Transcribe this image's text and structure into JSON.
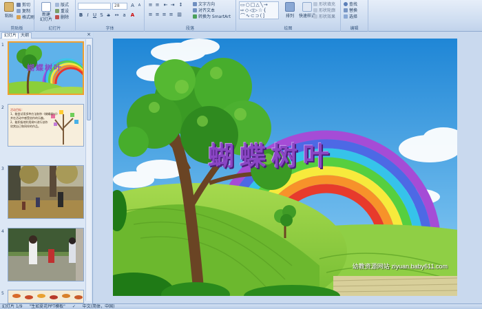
{
  "ribbon": {
    "clipboard": {
      "label": "剪贴板",
      "paste": "粘贴",
      "cut": "剪切",
      "copy": "复制",
      "format_painter": "格式刷"
    },
    "slides": {
      "label": "幻灯片",
      "new_slide": "新建\n幻灯片",
      "layout": "版式",
      "reset": "重设",
      "delete": "删除"
    },
    "font": {
      "label": "字体",
      "font_name": "",
      "font_size": "28"
    },
    "paragraph": {
      "label": "段落",
      "text_direction": "文字方向",
      "align_text": "对齐文本",
      "smartart": "转换为 SmartArt"
    },
    "drawing": {
      "label": "绘图",
      "arrange": "排列",
      "quick_styles": "快速样式",
      "shape_fill": "形状填充",
      "shape_outline": "形状轮廓",
      "shape_effects": "形状效果"
    },
    "editing": {
      "label": "编辑",
      "find": "查找",
      "replace": "替换",
      "select": "选择"
    }
  },
  "panel": {
    "tab_slides": "幻灯片",
    "tab_outline": "大纲",
    "close": "×",
    "slide_numbers": [
      "1",
      "2",
      "3",
      "4",
      "5"
    ],
    "thumb1_title": "蝴蝶树叶",
    "thumb2_lines": [
      "活动目标：",
      "1、能尝试用多种方法制作《蝴蝶树叶》",
      "并在活动中感受创作的乐趣。",
      "2、能积极地利用树叶进行创作",
      "欣赏自己和同伴的作品。"
    ]
  },
  "slide": {
    "title": "蝴蝶树叶",
    "watermark": "幼教资源网站 ziyuan.baby611.com"
  },
  "status": {
    "slide_info": "幻灯片 1/9",
    "theme": "\"生如夏花PPT模板\"",
    "language": "中文(简体，中国)"
  },
  "colors": {
    "ribbon_bg": "#cddcf0",
    "sky": "#4fa6e6",
    "title_purple": "#8a46c4",
    "selected_thumb": "#f0a030"
  }
}
